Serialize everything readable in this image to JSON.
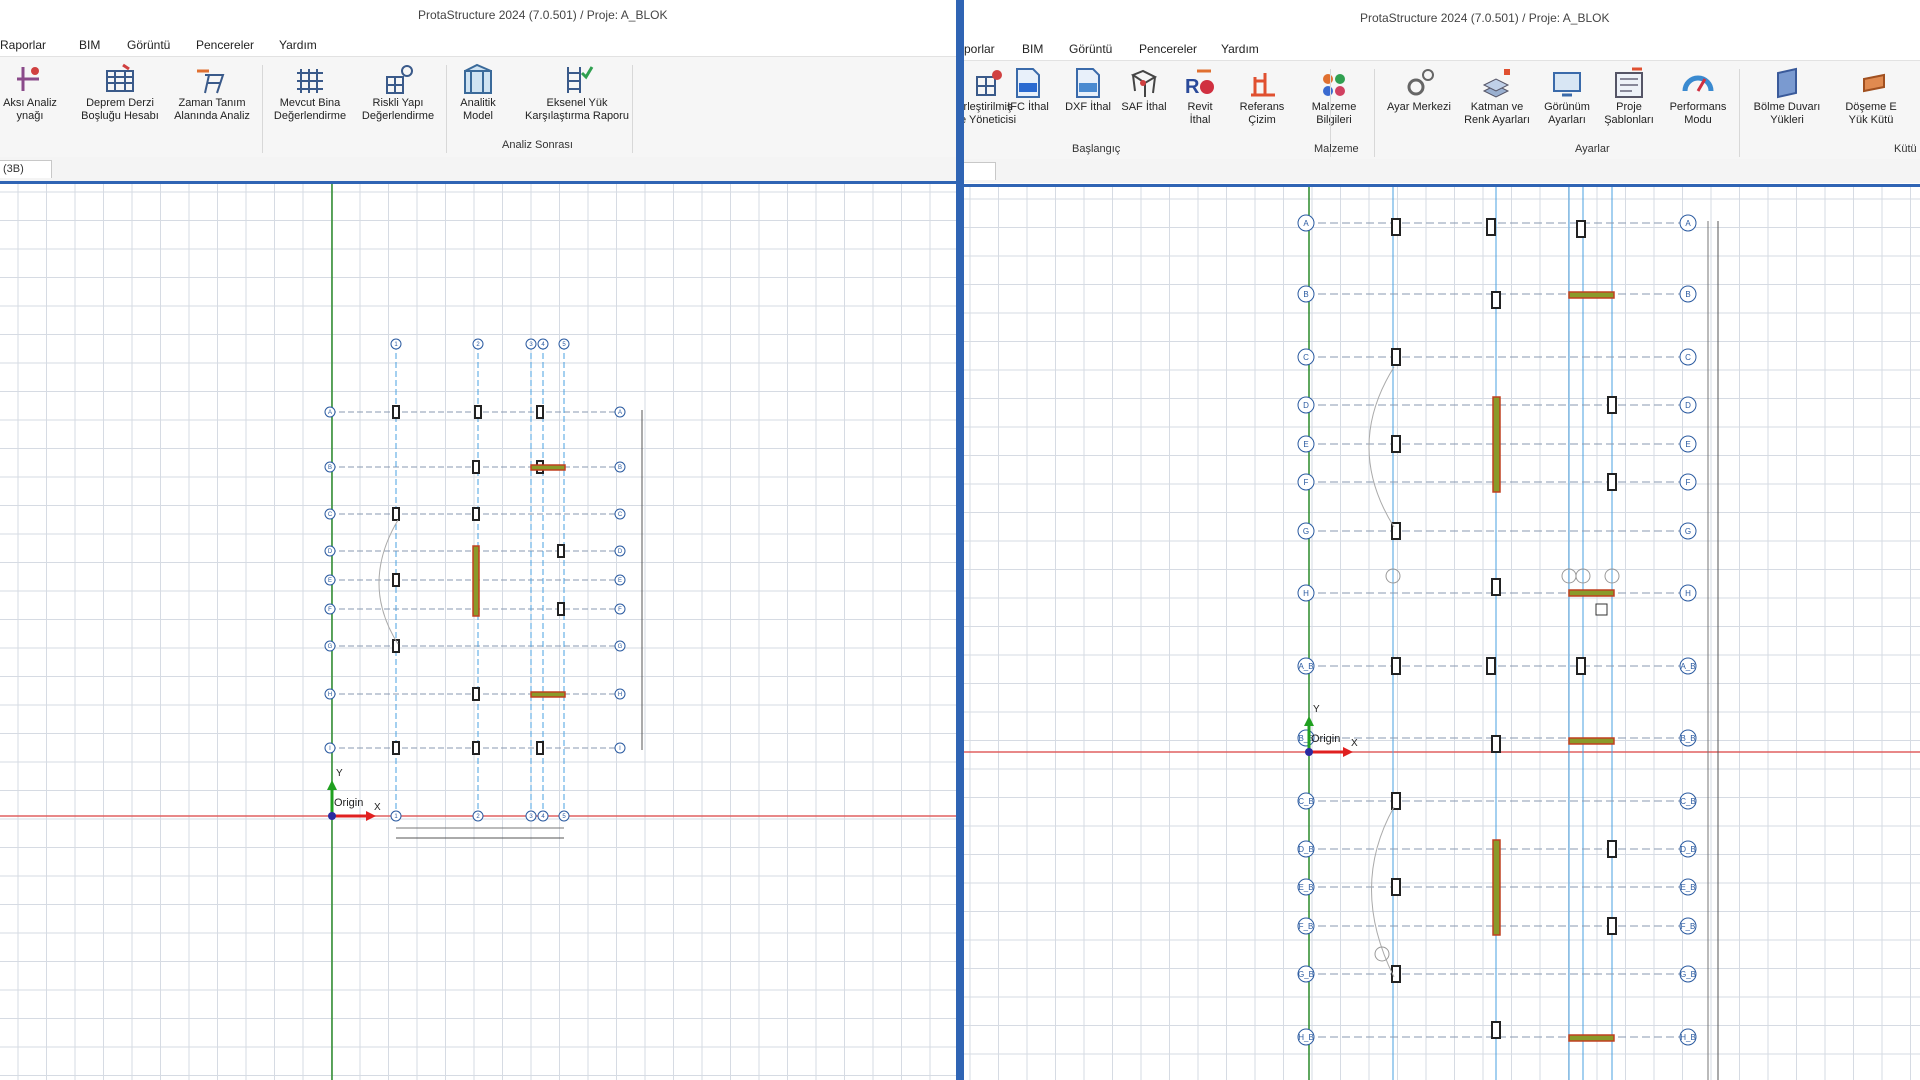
{
  "left": {
    "title": "ProtaStructure 2024 (7.0.501) / Proje: A_BLOK",
    "menu": [
      "Raporlar",
      "BIM",
      "Görüntü",
      "Pencereler",
      "Yardım"
    ],
    "ribbon": [
      {
        "label": "Aksı Analiz\nynağı",
        "icon": "axis-analysis-icon"
      },
      {
        "label": "Deprem Derzi\nBoşluğu Hesabı",
        "icon": "seismic-joint-icon"
      },
      {
        "label": "Zaman Tanım\nAlanında Analiz",
        "icon": "time-history-icon"
      },
      {
        "label": "Mevcut Bina\nDeğerlendirme",
        "icon": "existing-building-icon"
      },
      {
        "label": "Riskli Yapı\nDeğerlendirme",
        "icon": "risky-structure-icon"
      },
      {
        "label": "Analitik\nModel",
        "icon": "analytical-model-icon"
      },
      {
        "label": "Eksenel Yük\nKarşılaştırma Raporu",
        "icon": "axial-load-report-icon"
      }
    ],
    "group_label": "Analiz Sonrası",
    "tab_label": "(3B)",
    "origin_label": "Origin",
    "x_axis_label": "X",
    "y_axis_label": "Y",
    "grid_rows": [
      "A",
      "B",
      "C",
      "D",
      "E",
      "F",
      "G",
      "H",
      "I"
    ],
    "grid_cols": [
      "1",
      "2",
      "3",
      "4",
      "5"
    ]
  },
  "right": {
    "title": "ProtaStructure 2024 (7.0.501) / Proje: A_BLOK",
    "menu": [
      "porlar",
      "BIM",
      "Görüntü",
      "Pencereler",
      "Yardım"
    ],
    "ribbon": [
      {
        "label": "rleştirilmiş\ne Yöneticisi",
        "icon": "integrated-manager-icon"
      },
      {
        "label": "IFC İthal",
        "icon": "ifc-import-icon"
      },
      {
        "label": "DXF İthal",
        "icon": "dxf-import-icon"
      },
      {
        "label": "SAF İthal",
        "icon": "saf-import-icon"
      },
      {
        "label": "Revit\nİthal",
        "icon": "revit-import-icon"
      },
      {
        "label": "Referans\nÇizim",
        "icon": "reference-drawing-icon"
      },
      {
        "label": "Malzeme\nBilgileri",
        "icon": "material-info-icon"
      },
      {
        "label": "Ayar Merkezi",
        "icon": "settings-center-icon"
      },
      {
        "label": "Katman ve\nRenk Ayarları",
        "icon": "layer-color-icon"
      },
      {
        "label": "Görünüm\nAyarları",
        "icon": "view-settings-icon"
      },
      {
        "label": "Proje\nŞablonları",
        "icon": "project-templates-icon"
      },
      {
        "label": "Performans\nModu",
        "icon": "performance-mode-icon"
      },
      {
        "label": "Bölme Duvarı\nYükleri",
        "icon": "partition-wall-icon"
      },
      {
        "label": "Döşeme E\nYük Kütü",
        "icon": "slab-load-icon"
      }
    ],
    "groups": [
      "Başlangıç",
      "Malzeme",
      "Ayarlar",
      "Kütü"
    ],
    "origin_label": "Origin",
    "x_axis_label": "X",
    "y_axis_label": "Y",
    "grid_rows": [
      "A",
      "B",
      "C",
      "D",
      "E",
      "F",
      "G",
      "H",
      "A_B",
      "B_B",
      "C_B",
      "D_B",
      "E_B",
      "F_B",
      "G_B",
      "H_B"
    ]
  }
}
